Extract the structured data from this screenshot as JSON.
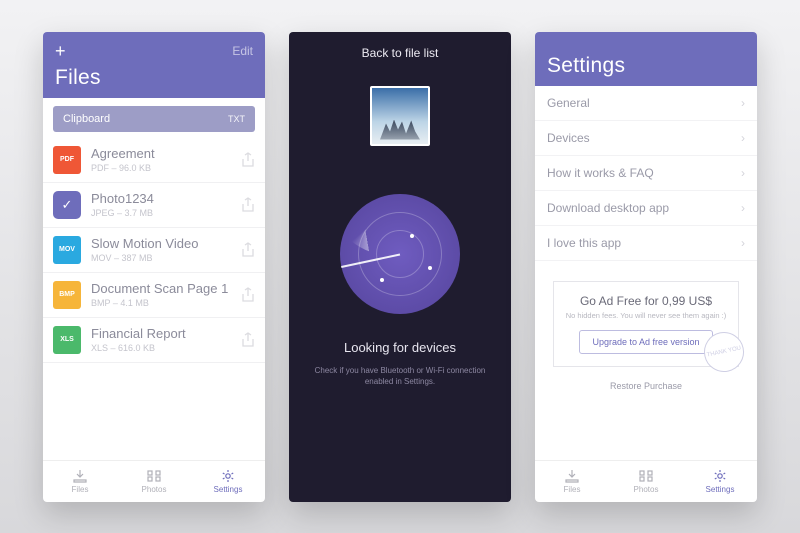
{
  "screen1": {
    "edit_label": "Edit",
    "title": "Files",
    "clipboard": {
      "label": "Clipboard",
      "ext": "TXT"
    },
    "items": [
      {
        "badge_text": "PDF",
        "badge_color": "#ef5736",
        "name": "Agreement",
        "meta": "PDF – 96.0 KB",
        "selected": false
      },
      {
        "badge_text": "",
        "badge_color": "#6e6dbb",
        "name": "Photo1234",
        "meta": "JPEG – 3.7 MB",
        "selected": true
      },
      {
        "badge_text": "MOV",
        "badge_color": "#2aa9e0",
        "name": "Slow Motion Video",
        "meta": "MOV – 387 MB",
        "selected": false
      },
      {
        "badge_text": "BMP",
        "badge_color": "#f6b53a",
        "name": "Document Scan Page 1",
        "meta": "BMP – 4.1 MB",
        "selected": false
      },
      {
        "badge_text": "XLS",
        "badge_color": "#4bb96b",
        "name": "Financial Report",
        "meta": "XLS – 616.0 KB",
        "selected": false
      }
    ]
  },
  "screen2": {
    "back_label": "Back to file list",
    "status": "Looking for devices",
    "hint": "Check if you have Bluetooth or Wi-Fi connection enabled in Settings."
  },
  "screen3": {
    "title": "Settings",
    "rows": [
      {
        "label": "General"
      },
      {
        "label": "Devices"
      },
      {
        "label": "How it works & FAQ"
      },
      {
        "label": "Download desktop app"
      },
      {
        "label": "I love this app"
      }
    ],
    "promo": {
      "title": "Go Ad Free for 0,99 US$",
      "sub": "No hidden fees. You will never see them again :)",
      "button": "Upgrade to Ad free version",
      "stamp": "THANK YOU"
    },
    "restore": "Restore Purchase"
  },
  "tabs": [
    {
      "label": "Files"
    },
    {
      "label": "Photos"
    },
    {
      "label": "Settings"
    }
  ]
}
